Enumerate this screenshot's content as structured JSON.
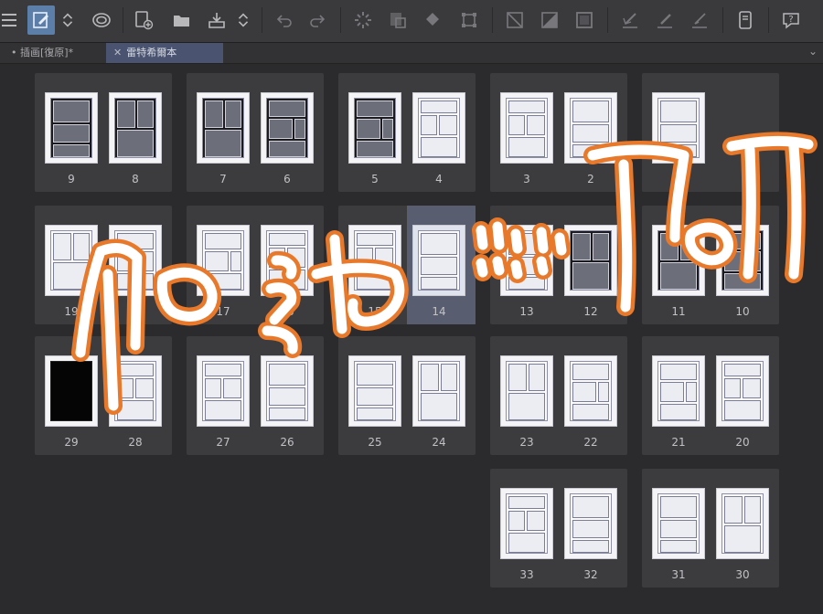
{
  "tabs": [
    {
      "label": "插画[復原]*",
      "active": false
    },
    {
      "label": "雷特希爾本",
      "active": true
    }
  ],
  "toolbar": {
    "buttons": [
      {
        "icon": "hamburger-menu-icon"
      },
      {
        "icon": "edit-page-icon",
        "active": true
      },
      {
        "icon": "sort-arrows-icon"
      },
      {
        "icon": "spiral-icon"
      },
      {
        "icon": "new-page-icon"
      },
      {
        "icon": "open-folder-icon"
      },
      {
        "icon": "export-icon"
      },
      {
        "icon": "sort-arrows-icon"
      },
      {
        "icon": "undo-icon"
      },
      {
        "icon": "redo-icon"
      },
      {
        "icon": "loading-spinner-icon"
      },
      {
        "icon": "clear-layer-icon"
      },
      {
        "icon": "fill-icon"
      },
      {
        "icon": "transform-icon"
      },
      {
        "icon": "selection-icon"
      },
      {
        "icon": "gradient-icon"
      },
      {
        "icon": "square-icon"
      },
      {
        "icon": "pen-check-icon"
      },
      {
        "icon": "brush-icon"
      },
      {
        "icon": "pencil-icon"
      },
      {
        "icon": "smartphone-icon"
      },
      {
        "icon": "help-icon"
      }
    ]
  },
  "spreads": [
    {
      "left": {
        "num": "9",
        "style": "dark"
      },
      "right": {
        "num": "8",
        "style": "dark"
      }
    },
    {
      "left": {
        "num": "7",
        "style": "dark"
      },
      "right": {
        "num": "6",
        "style": "dark"
      }
    },
    {
      "left": {
        "num": "5",
        "style": "dark"
      },
      "right": {
        "num": "4",
        "style": "light"
      }
    },
    {
      "left": {
        "num": "3",
        "style": "light"
      },
      "right": {
        "num": "2",
        "style": "light"
      }
    },
    {
      "left": {
        "num": "1",
        "style": "light"
      },
      "right": null
    },
    {
      "left": {
        "num": "19",
        "style": "sketch"
      },
      "right": {
        "num": "18",
        "style": "sketch"
      }
    },
    {
      "left": {
        "num": "17",
        "style": "sketch"
      },
      "right": {
        "num": "16",
        "style": "sketch"
      }
    },
    {
      "left": {
        "num": "15",
        "style": "sketch"
      },
      "right": {
        "num": "14",
        "style": "sketch",
        "highlight": true
      }
    },
    {
      "left": {
        "num": "13",
        "style": "light"
      },
      "right": {
        "num": "12",
        "style": "dark"
      }
    },
    {
      "left": {
        "num": "11",
        "style": "dark"
      },
      "right": {
        "num": "10",
        "style": "dark"
      }
    },
    {
      "left": {
        "num": "29",
        "style": "black"
      },
      "right": {
        "num": "28",
        "style": "light"
      }
    },
    {
      "left": {
        "num": "27",
        "style": "sketch"
      },
      "right": {
        "num": "26",
        "style": "sketch"
      }
    },
    {
      "left": {
        "num": "25",
        "style": "sketch"
      },
      "right": {
        "num": "24",
        "style": "sketch"
      }
    },
    {
      "left": {
        "num": "23",
        "style": "sketch"
      },
      "right": {
        "num": "22",
        "style": "sketch"
      }
    },
    {
      "left": {
        "num": "21",
        "style": "sketch"
      },
      "right": {
        "num": "20",
        "style": "sketch"
      }
    },
    {
      "left": {
        "num": "33",
        "style": "sketch"
      },
      "right": {
        "num": "32",
        "style": "sketch"
      }
    },
    {
      "left": {
        "num": "31",
        "style": "sketch"
      },
      "right": {
        "num": "30",
        "style": "sketch"
      }
    }
  ],
  "colors": {
    "scribble": "#e8792a",
    "selection": "#6f7a98"
  }
}
